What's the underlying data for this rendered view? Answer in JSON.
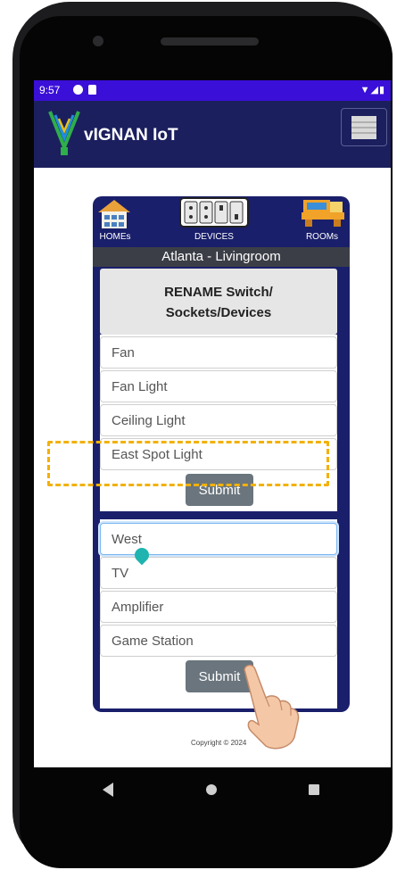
{
  "status_bar": {
    "time": "9:57",
    "right_icons": "▼◢▮"
  },
  "app": {
    "title": "vIGNAN IoT"
  },
  "nav": {
    "homes": "HOMEs",
    "devices": "DEVICES",
    "rooms": "ROOMs"
  },
  "location": "Atlanta - Livingroom",
  "section": {
    "title_line1": "RENAME Switch/",
    "title_line2": "Sockets/Devices"
  },
  "group1": {
    "fields": [
      "Fan",
      "Fan Light",
      "Ceiling Light",
      "East Spot Light"
    ],
    "submit": "Submit"
  },
  "group2": {
    "fields": [
      "West",
      "TV",
      "Amplifier",
      "Game Station"
    ],
    "submit": "Submit"
  },
  "copyright": "Copyright © 2024",
  "colors": {
    "status_bar": "#3a0fd8",
    "app_bar": "#1b1f5e",
    "card": "#1a1f6b",
    "submit_button": "#6a757d",
    "highlight": "#f2b10a"
  }
}
